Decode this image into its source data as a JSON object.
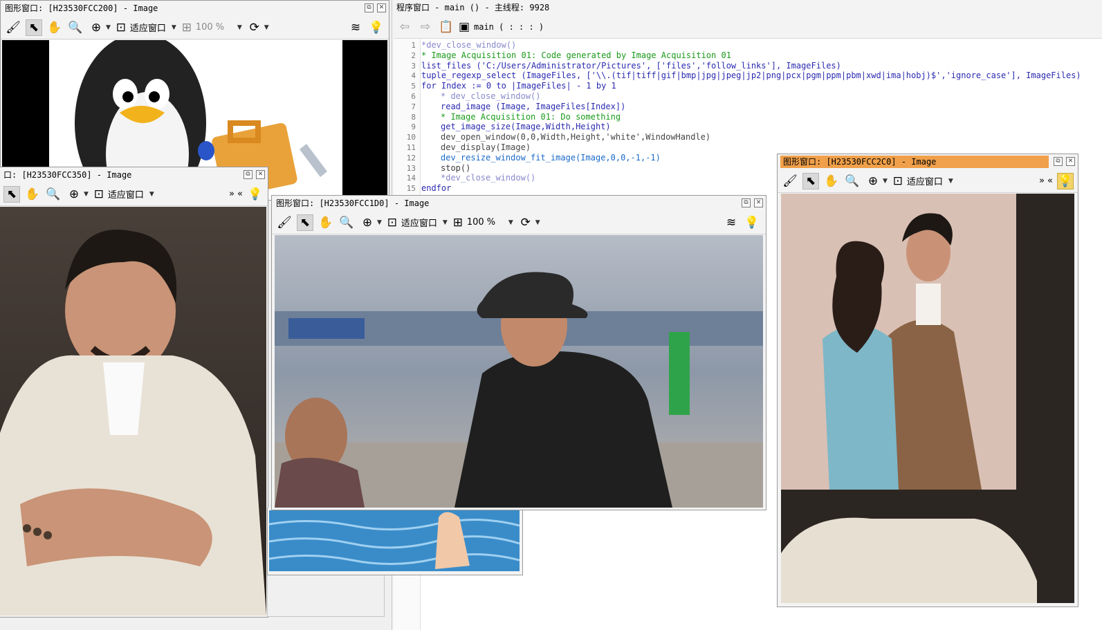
{
  "program_window": {
    "title": "程序窗口 - main () - 主线程: 9928",
    "procedure": "main ( : : : )",
    "lines": [
      {
        "n": "1",
        "text": "*dev_close_window()",
        "cls": "c-dis",
        "indent": 0
      },
      {
        "n": "2",
        "text": "* Image Acquisition 01: Code generated by Image Acquisition 01",
        "cls": "c-cm",
        "indent": 0
      },
      {
        "n": "3",
        "text": "list_files ('C:/Users/Administrator/Pictures', ['files','follow_links'], ImageFiles)",
        "cls": "c-op",
        "indent": 0
      },
      {
        "n": "4",
        "text": "tuple_regexp_select (ImageFiles, ['\\\\.(tif|tiff|gif|bmp|jpg|jpeg|jp2|png|pcx|pgm|ppm|pbm|xwd|ima|hobj)$','ignore_case'], ImageFiles)",
        "cls": "c-op",
        "indent": 0
      },
      {
        "n": "5",
        "text": "for Index := 0 to |ImageFiles| - 1 by 1",
        "cls": "c-kw",
        "indent": 0
      },
      {
        "n": "6",
        "text": "* dev_close_window()",
        "cls": "c-dis",
        "indent": 1
      },
      {
        "n": "7",
        "text": "read_image (Image, ImageFiles[Index])",
        "cls": "c-op",
        "indent": 1
      },
      {
        "n": "8",
        "text": "* Image Acquisition 01: Do something",
        "cls": "c-cm",
        "indent": 1
      },
      {
        "n": "9",
        "text": "get_image_size(Image,Width,Height)",
        "cls": "c-op",
        "indent": 1
      },
      {
        "n": "10",
        "text": "dev_open_window(0,0,Width,Height,'white',WindowHandle)",
        "cls": "c-dev",
        "indent": 1
      },
      {
        "n": "11",
        "text": "dev_display(Image)",
        "cls": "c-dev",
        "indent": 1
      },
      {
        "n": "12",
        "text": "dev_resize_window_fit_image(Image,0,0,-1,-1)",
        "cls": "c-fit",
        "indent": 1
      },
      {
        "n": "13",
        "text": "stop()",
        "cls": "c-ctl",
        "indent": 1
      },
      {
        "n": "14",
        "text": "*dev_close_window()",
        "cls": "c-dis",
        "indent": 1
      },
      {
        "n": "15",
        "text": "endfor",
        "cls": "c-kw",
        "indent": 0
      }
    ]
  },
  "graphics_windows": {
    "w200": {
      "title": "图形窗口: [H23530FCC200] - Image",
      "fit_label": "适应窗口",
      "zoom": "100 %"
    },
    "w350": {
      "title": "口: [H23530FCC350] - Image",
      "fit_label": "适应窗口",
      "more": "» «"
    },
    "w1d0": {
      "title": "图形窗口: [H23530FCC1D0] - Image",
      "fit_label": "适应窗口",
      "zoom": "100 %"
    },
    "w2c0": {
      "title": "图形窗口: [H23530FCC2C0] - Image",
      "fit_label": "适应窗口",
      "more": "» «"
    }
  },
  "icons": {
    "brush": "🖌",
    "pointer": "⬉",
    "hand": "✋",
    "magnifier": "🔍",
    "zoom_in": "⊕",
    "fit": "⊡",
    "zoom_box": "⊞",
    "shapes": "⟳",
    "layers": "≋",
    "bulb": "💡",
    "restore": "⧉",
    "close": "✕",
    "back": "⇦",
    "forward": "⇨",
    "clipboard": "📋",
    "procedure": "▣"
  },
  "colors": {
    "active_title": "#f0a04a",
    "comment": "#1a9a1a",
    "operator": "#2a2ab0"
  }
}
